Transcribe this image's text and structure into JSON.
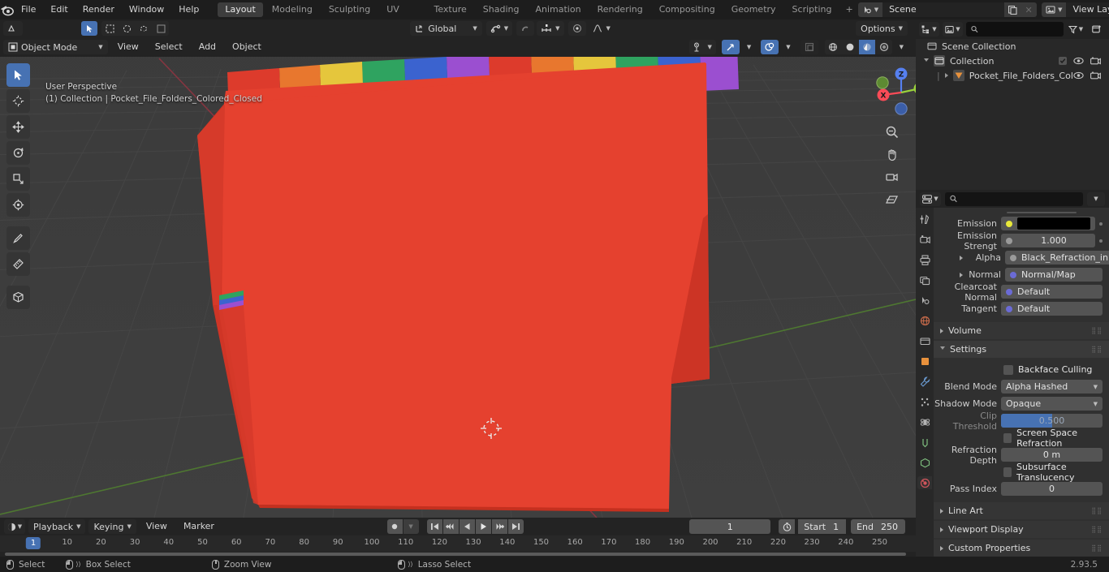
{
  "app": {
    "version": "2.93.5",
    "logo_icon": "blender-logo"
  },
  "topbar": {
    "menus": [
      "File",
      "Edit",
      "Render",
      "Window",
      "Help"
    ],
    "workspace_tabs": [
      {
        "label": "Layout",
        "active": true
      },
      {
        "label": "Modeling",
        "active": false
      },
      {
        "label": "Sculpting",
        "active": false
      },
      {
        "label": "UV Editing",
        "active": false
      },
      {
        "label": "Texture Paint",
        "active": false
      },
      {
        "label": "Shading",
        "active": false
      },
      {
        "label": "Animation",
        "active": false
      },
      {
        "label": "Rendering",
        "active": false
      },
      {
        "label": "Compositing",
        "active": false
      },
      {
        "label": "Geometry Nodes",
        "active": false
      },
      {
        "label": "Scripting",
        "active": false
      }
    ],
    "add_workspace_label": "+",
    "scene": {
      "name": "Scene",
      "icon": "scene-icon",
      "new_icon": "copy-icon",
      "unlink_icon": "x-icon"
    },
    "view_layer": {
      "name": "View Layer",
      "icon": "viewlayer-icon",
      "new_icon": "copy-icon",
      "unlink_icon": "x-icon"
    }
  },
  "viewport": {
    "mode": "Object Mode",
    "menus": [
      "View",
      "Select",
      "Add",
      "Object"
    ],
    "transform_orientation": "Global",
    "snap_icon": "magnet-icon",
    "proportional_icon": "proportional-editing-icon",
    "options_label": "Options",
    "overlay_text_line1": "User Perspective",
    "overlay_text_line2": "(1) Collection | Pocket_File_Folders_Colored_Closed",
    "gizmo_axes": [
      {
        "label": "Z",
        "color": "#5680f0"
      },
      {
        "label": "Y",
        "color": "#9ad13c"
      },
      {
        "label": "X",
        "color": "#fb4b57"
      }
    ],
    "nav_buttons": [
      "zoom-icon",
      "pan-hand-icon",
      "camera-view-icon",
      "toggle-ortho-icon"
    ],
    "tools": [
      {
        "name": "tweak-select-tool",
        "icon": "cursor-arrow-icon",
        "active": true
      },
      {
        "name": "cursor-tool",
        "icon": "3d-cursor-icon",
        "active": false
      },
      {
        "name": "move-tool",
        "icon": "move-arrows-icon",
        "active": false
      },
      {
        "name": "rotate-tool",
        "icon": "rotate-icon",
        "active": false
      },
      {
        "name": "scale-tool",
        "icon": "scale-icon",
        "active": false
      },
      {
        "name": "transform-tool",
        "icon": "transform-icon",
        "active": false
      },
      {
        "name": "annotate-tool",
        "icon": "pencil-icon",
        "active": false
      },
      {
        "name": "measure-tool",
        "icon": "ruler-icon",
        "active": false
      },
      {
        "name": "add-cube-tool",
        "icon": "add-cube-icon",
        "active": false
      }
    ],
    "shading_modes": [
      {
        "name": "wireframe",
        "active": false
      },
      {
        "name": "solid",
        "active": false
      },
      {
        "name": "material-preview",
        "active": true
      },
      {
        "name": "rendered",
        "active": false
      }
    ],
    "object": {
      "name": "Pocket_File_Folders_Colored_Closed",
      "body_color": "#e13b2b",
      "tab_colors": [
        "#e13b2b",
        "#e8772e",
        "#e5c63c",
        "#2fa360",
        "#3b63cf",
        "#9b4fd0",
        "#dd3b2c",
        "#e8772e",
        "#e5c63c",
        "#2fa360",
        "#3b63cf",
        "#9b4fd0"
      ]
    }
  },
  "outliner": {
    "display_mode_icon": "outliner-icon",
    "filter_icon": "filter-funnel-icon",
    "new_collection_icon": "new-collection-icon",
    "search_placeholder": "",
    "rows": [
      {
        "label": "Scene Collection",
        "icon": "scene-collection-icon",
        "indent": 0,
        "has_checkbox": false,
        "has_eye": false,
        "has_camera": false,
        "expander": "none"
      },
      {
        "label": "Collection",
        "icon": "collection-icon",
        "indent": 1,
        "has_checkbox": true,
        "has_eye": true,
        "has_camera": true,
        "expander": "down"
      },
      {
        "label": "Pocket_File_Folders_Colo",
        "icon": "mesh-object-icon",
        "indent": 2,
        "has_checkbox": false,
        "has_eye": true,
        "has_camera": true,
        "expander": "right"
      }
    ]
  },
  "properties": {
    "editor_icon": "properties-editor-icon",
    "search_placeholder": "",
    "tabs": [
      {
        "name": "tool",
        "icon": "tool-icon",
        "active": false
      },
      {
        "name": "render",
        "icon": "render-camera-icon",
        "active": false
      },
      {
        "name": "output",
        "icon": "printer-icon",
        "active": false
      },
      {
        "name": "view-layer",
        "icon": "images-icon",
        "active": false
      },
      {
        "name": "scene",
        "icon": "scene-cone-icon",
        "active": false
      },
      {
        "name": "world",
        "icon": "world-globe-icon",
        "active": false
      },
      {
        "name": "collection",
        "icon": "collection-box-icon",
        "active": false
      },
      {
        "name": "object",
        "icon": "object-square-icon",
        "active": false
      },
      {
        "name": "modifiers",
        "icon": "wrench-icon",
        "active": false
      },
      {
        "name": "particles",
        "icon": "particles-icon",
        "active": false
      },
      {
        "name": "physics",
        "icon": "physics-orbit-icon",
        "active": false
      },
      {
        "name": "constraints",
        "icon": "constraints-icon",
        "active": false
      },
      {
        "name": "data",
        "icon": "mesh-data-icon",
        "active": false
      },
      {
        "name": "material",
        "icon": "material-sphere-icon",
        "active": true
      }
    ],
    "fields": [
      {
        "label": "Emission",
        "type": "color",
        "value": "#000000",
        "socket": "#e8e83a",
        "dot": true
      },
      {
        "label": "Emission Strengt",
        "type": "value",
        "value": "1.000",
        "socket": "#9a9a9a",
        "dot": true
      },
      {
        "label": "Alpha",
        "type": "link",
        "value": "Black_Refraction_in...",
        "socket": "#9a9a9a",
        "expander": true
      },
      {
        "label": "Normal",
        "type": "link",
        "value": "Normal/Map",
        "socket": "#6b6bd6",
        "expander": true
      },
      {
        "label": "Clearcoat Normal",
        "type": "link",
        "value": "Default",
        "socket": "#6b6bd6",
        "expander": false
      },
      {
        "label": "Tangent",
        "type": "link",
        "value": "Default",
        "socket": "#6b6bd6",
        "expander": false
      }
    ],
    "panels": [
      {
        "label": "Volume",
        "open": false
      },
      {
        "label": "Settings",
        "open": true
      }
    ],
    "settings": {
      "backface_culling": {
        "label": "Backface Culling",
        "checked": false
      },
      "blend_mode": {
        "label": "Blend Mode",
        "value": "Alpha Hashed"
      },
      "shadow_mode": {
        "label": "Shadow Mode",
        "value": "Opaque"
      },
      "clip_threshold": {
        "label": "Clip Threshold",
        "value": "0.500",
        "fill_percent": 50,
        "disabled": true
      },
      "screen_space_refraction": {
        "label": "Screen Space Refraction",
        "checked": false
      },
      "refraction_depth": {
        "label": "Refraction Depth",
        "value": "0 m"
      },
      "subsurface_translucency": {
        "label": "Subsurface Translucency",
        "checked": false
      },
      "pass_index": {
        "label": "Pass Index",
        "value": "0"
      }
    },
    "bottom_panels": [
      {
        "label": "Line Art",
        "open": false
      },
      {
        "label": "Viewport Display",
        "open": false
      },
      {
        "label": "Custom Properties",
        "open": false
      }
    ]
  },
  "timeline": {
    "editor_icon": "timeline-icon",
    "menus": [
      "Playback",
      "Keying",
      "View",
      "Marker"
    ],
    "record_icon": "record-dot-icon",
    "transport": [
      "jump-start-icon",
      "prev-keyframe-icon",
      "play-reverse-icon",
      "play-icon",
      "next-keyframe-icon",
      "jump-end-icon"
    ],
    "current_frame": "1",
    "auto_key_icon": "stopwatch-icon",
    "start_label": "Start",
    "start_value": "1",
    "end_label": "End",
    "end_value": "250",
    "ruler_ticks": [
      "10",
      "20",
      "30",
      "40",
      "50",
      "60",
      "70",
      "80",
      "90",
      "100",
      "110",
      "120",
      "130",
      "140",
      "150",
      "160",
      "170",
      "180",
      "190",
      "200",
      "210",
      "220",
      "230",
      "240",
      "250"
    ],
    "playhead_label": "1"
  },
  "statusbar": {
    "items": [
      {
        "label": "Select",
        "icon": "mouse-left-icon"
      },
      {
        "label": "Box Select",
        "icon": "mouse-left-drag-icon"
      },
      {
        "label": "Zoom View",
        "icon": "mouse-middle-icon"
      },
      {
        "label": "Lasso Select",
        "icon": "mouse-left-drag-icon"
      }
    ],
    "version": "2.93.5"
  }
}
